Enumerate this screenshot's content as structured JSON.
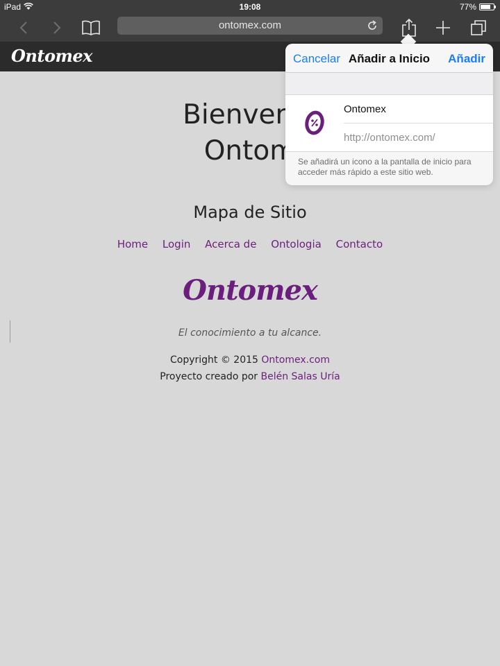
{
  "statusbar": {
    "device": "iPad",
    "time": "19:08",
    "battery": "77%",
    "battery_level": 0.77
  },
  "browser": {
    "address": "ontomex.com"
  },
  "site": {
    "header_logo": "Ontomex",
    "welcome_line1": "Bienvenid",
    "welcome_line2": "Ontom",
    "sitemap_title": "Mapa de Sitio",
    "nav": [
      "Home",
      "Login",
      "Acerca de",
      "Ontologia",
      "Contacto"
    ],
    "footer_logo": "Ontomex",
    "tagline": "El conocimiento a tu alcance.",
    "copyright_prefix": "Copyright © 2015 ",
    "copyright_link": "Ontomex.com",
    "credits_prefix": "Proyecto creado por ",
    "credits_link": "Belén Salas Uría"
  },
  "popover": {
    "cancel": "Cancelar",
    "title": "Añadir a Inicio",
    "add": "Añadir",
    "name_value": "Ontomex",
    "url": "http://ontomex.com/",
    "note": "Se añadirá un icono a la pantalla de inicio para acceder más rápido a este sitio web."
  },
  "colors": {
    "accent_blue": "#1a7ef5",
    "brand_purple": "#6b1f7c",
    "toolbar_dark": "#3c3c3c"
  },
  "icons": [
    "wifi-icon",
    "back-arrow-icon",
    "forward-arrow-icon",
    "bookmarks-book-icon",
    "reload-icon",
    "share-icon",
    "plus-icon",
    "tabs-icon",
    "site-icon"
  ]
}
